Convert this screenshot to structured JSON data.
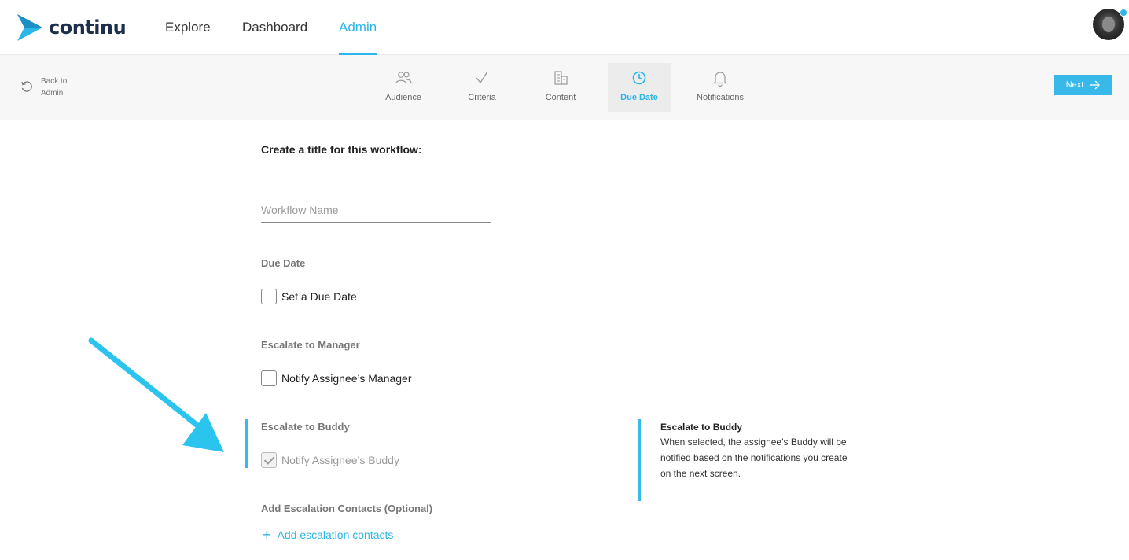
{
  "brand": {
    "name": "continu",
    "accent": "#2bb5e8"
  },
  "topnav": {
    "links": [
      {
        "label": "Explore",
        "active": false
      },
      {
        "label": "Dashboard",
        "active": false
      },
      {
        "label": "Admin",
        "active": true
      }
    ]
  },
  "subnav": {
    "back_label": "Back to Admin",
    "steps": [
      {
        "label": "Audience",
        "icon": "people-icon",
        "active": false
      },
      {
        "label": "Criteria",
        "icon": "checkmark-icon",
        "active": false
      },
      {
        "label": "Content",
        "icon": "building-icon",
        "active": false
      },
      {
        "label": "Due Date",
        "icon": "clock-icon",
        "active": true
      },
      {
        "label": "Notifications",
        "icon": "bell-icon",
        "active": false
      }
    ],
    "next_label": "Next"
  },
  "form": {
    "title_label": "Create a title for this workflow:",
    "workflow_name": {
      "value": "",
      "placeholder": "Workflow Name"
    },
    "due_date": {
      "section": "Due Date",
      "checkbox_label": "Set a Due Date",
      "checked": false
    },
    "escalate_manager": {
      "section": "Escalate to Manager",
      "checkbox_label": "Notify Assignee’s Manager",
      "checked": false
    },
    "escalate_buddy": {
      "section": "Escalate to Buddy",
      "checkbox_label": "Notify Assignee’s Buddy",
      "checked": true
    },
    "escalation_contacts": {
      "section": "Add Escalation Contacts (Optional)",
      "link_label": "Add escalation contacts"
    }
  },
  "help": {
    "title": "Escalate to Buddy",
    "body": "When selected, the assignee’s Buddy will be notified based on the notifications you create on the next screen."
  }
}
